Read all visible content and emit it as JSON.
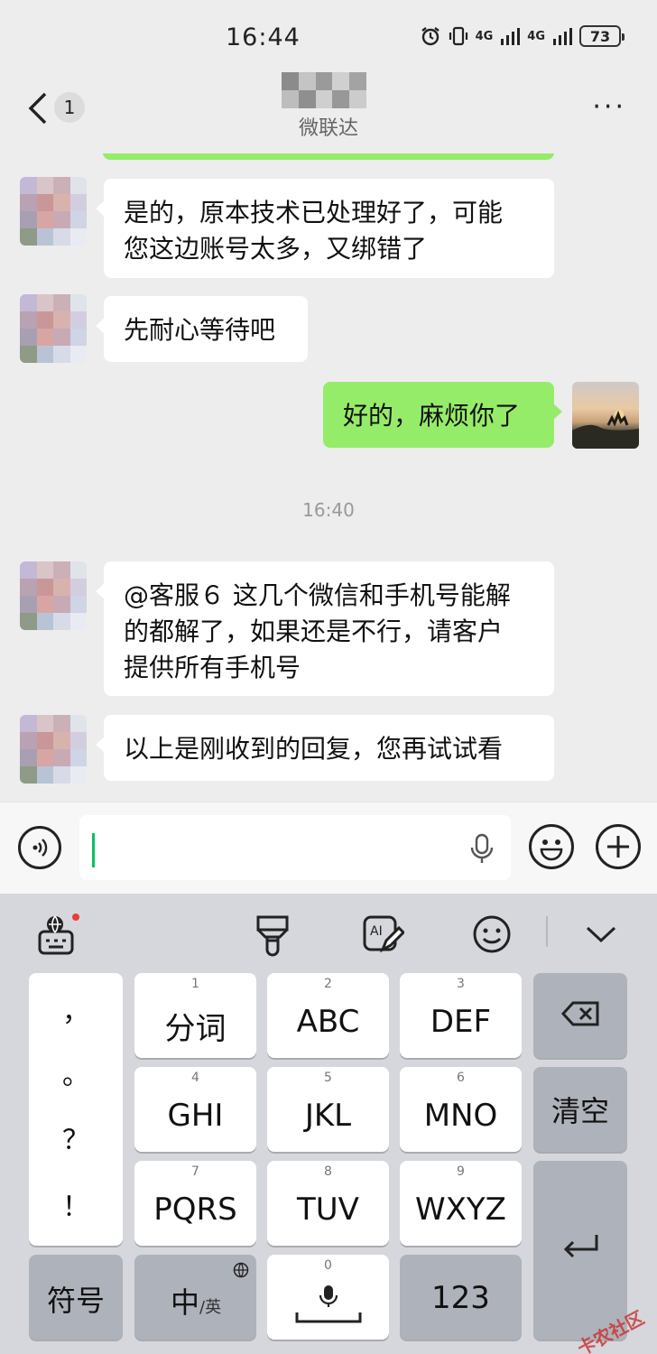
{
  "status_bar": {
    "time": "16:44",
    "signal_1": "4G",
    "signal_2": "4G",
    "battery": "73"
  },
  "header": {
    "unread_count": "1",
    "subtitle": "微联达"
  },
  "messages": [
    {
      "direction": "in",
      "text_lines": [
        "是的，原本技术已处理好了，可能",
        "您这边账号太多，又绑错了"
      ]
    },
    {
      "direction": "in",
      "text_lines": [
        "先耐心等待吧"
      ]
    },
    {
      "direction": "out",
      "text_lines": [
        "好的，麻烦你了"
      ]
    },
    {
      "direction": "time",
      "text_lines": [
        "16:40"
      ]
    },
    {
      "direction": "in",
      "text_lines": [
        "@客服６ 这几个微信和手机号能解",
        "的都解了，如果还是不行，请客户",
        "提供所有手机号"
      ]
    },
    {
      "direction": "in",
      "text_lines": [
        "以上是刚收到的回复，您再试试看"
      ]
    }
  ],
  "keyboard": {
    "keys": [
      {
        "num": "1",
        "label": "分词"
      },
      {
        "num": "2",
        "label": "ABC"
      },
      {
        "num": "3",
        "label": "DEF"
      },
      {
        "num": "4",
        "label": "GHI"
      },
      {
        "num": "5",
        "label": "JKL"
      },
      {
        "num": "6",
        "label": "MNO"
      },
      {
        "num": "7",
        "label": "PQRS"
      },
      {
        "num": "8",
        "label": "TUV"
      },
      {
        "num": "9",
        "label": "WXYZ"
      }
    ],
    "punctuation": [
      "，",
      "。",
      "？",
      "！"
    ],
    "clear_label": "清空",
    "symbol_label": "符号",
    "lang_label_main": "中",
    "lang_label_sub": "/英",
    "space_num": "0",
    "num_label": "123"
  },
  "watermark": "卡农社区",
  "colors": {
    "chat_bg": "#ededed",
    "bubble_out": "#95ec69",
    "bubble_in": "#ffffff",
    "cursor": "#07c160",
    "keyboard_bg": "#d5d7dc"
  }
}
